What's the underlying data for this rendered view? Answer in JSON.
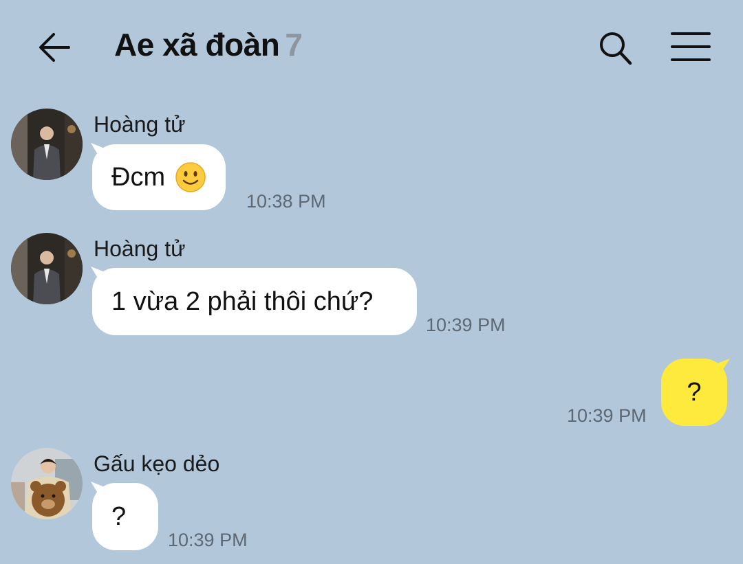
{
  "header": {
    "title": "Ae xã đoàn",
    "member_count": "7",
    "back_icon": "arrow-left-icon",
    "search_icon": "search-icon",
    "menu_icon": "hamburger-menu-icon"
  },
  "messages": [
    {
      "sender": "Hoàng tử",
      "text": "Đcm",
      "emoji": "slightly-smiling-face",
      "time": "10:38 PM",
      "direction": "incoming"
    },
    {
      "sender": "Hoàng tử",
      "text": "1 vừa 2 phải thôi chứ?",
      "time": "10:39 PM",
      "direction": "incoming"
    },
    {
      "text": "?",
      "time": "10:39 PM",
      "direction": "outgoing"
    },
    {
      "sender": "Gấu kẹo dẻo",
      "text": "?",
      "time": "10:39 PM",
      "direction": "incoming"
    }
  ],
  "colors": {
    "background": "#b2c7da",
    "incoming_bubble": "#ffffff",
    "outgoing_bubble": "#fee93d",
    "timestamp": "#5d6872",
    "member_count": "#8d969e"
  }
}
